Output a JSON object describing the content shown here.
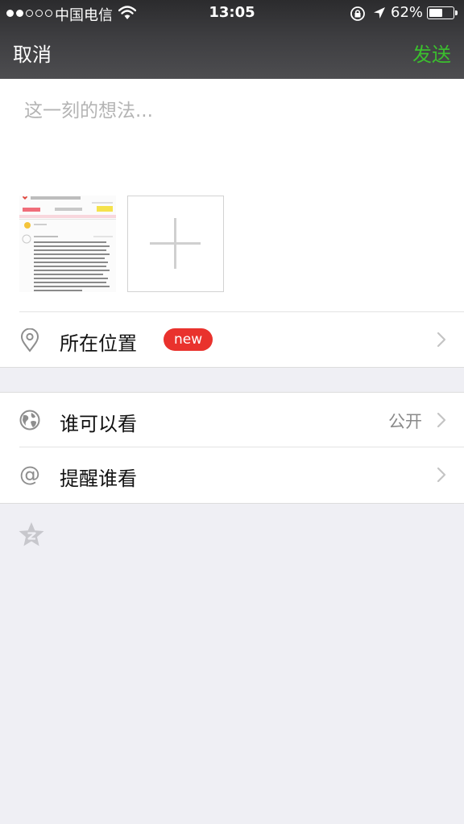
{
  "status_bar": {
    "carrier": "中国电信",
    "time": "13:05",
    "battery_percent": "62%",
    "battery_level": 0.62,
    "signal_strength": 2,
    "signal_max": 5
  },
  "nav": {
    "cancel_label": "取消",
    "send_label": "发送",
    "send_color": "#3bbf2e"
  },
  "compose": {
    "placeholder": "这一刻的想法...",
    "value": ""
  },
  "location": {
    "label": "所在位置",
    "badge": "new",
    "badge_color": "#e9322d",
    "icon": "location-pin-icon"
  },
  "visibility": {
    "label": "谁可以看",
    "value": "公开",
    "icon": "globe-icon"
  },
  "mention": {
    "label": "提醒谁看",
    "icon": "at-sign-icon"
  },
  "footer": {
    "icon": "qzone-star-icon"
  }
}
